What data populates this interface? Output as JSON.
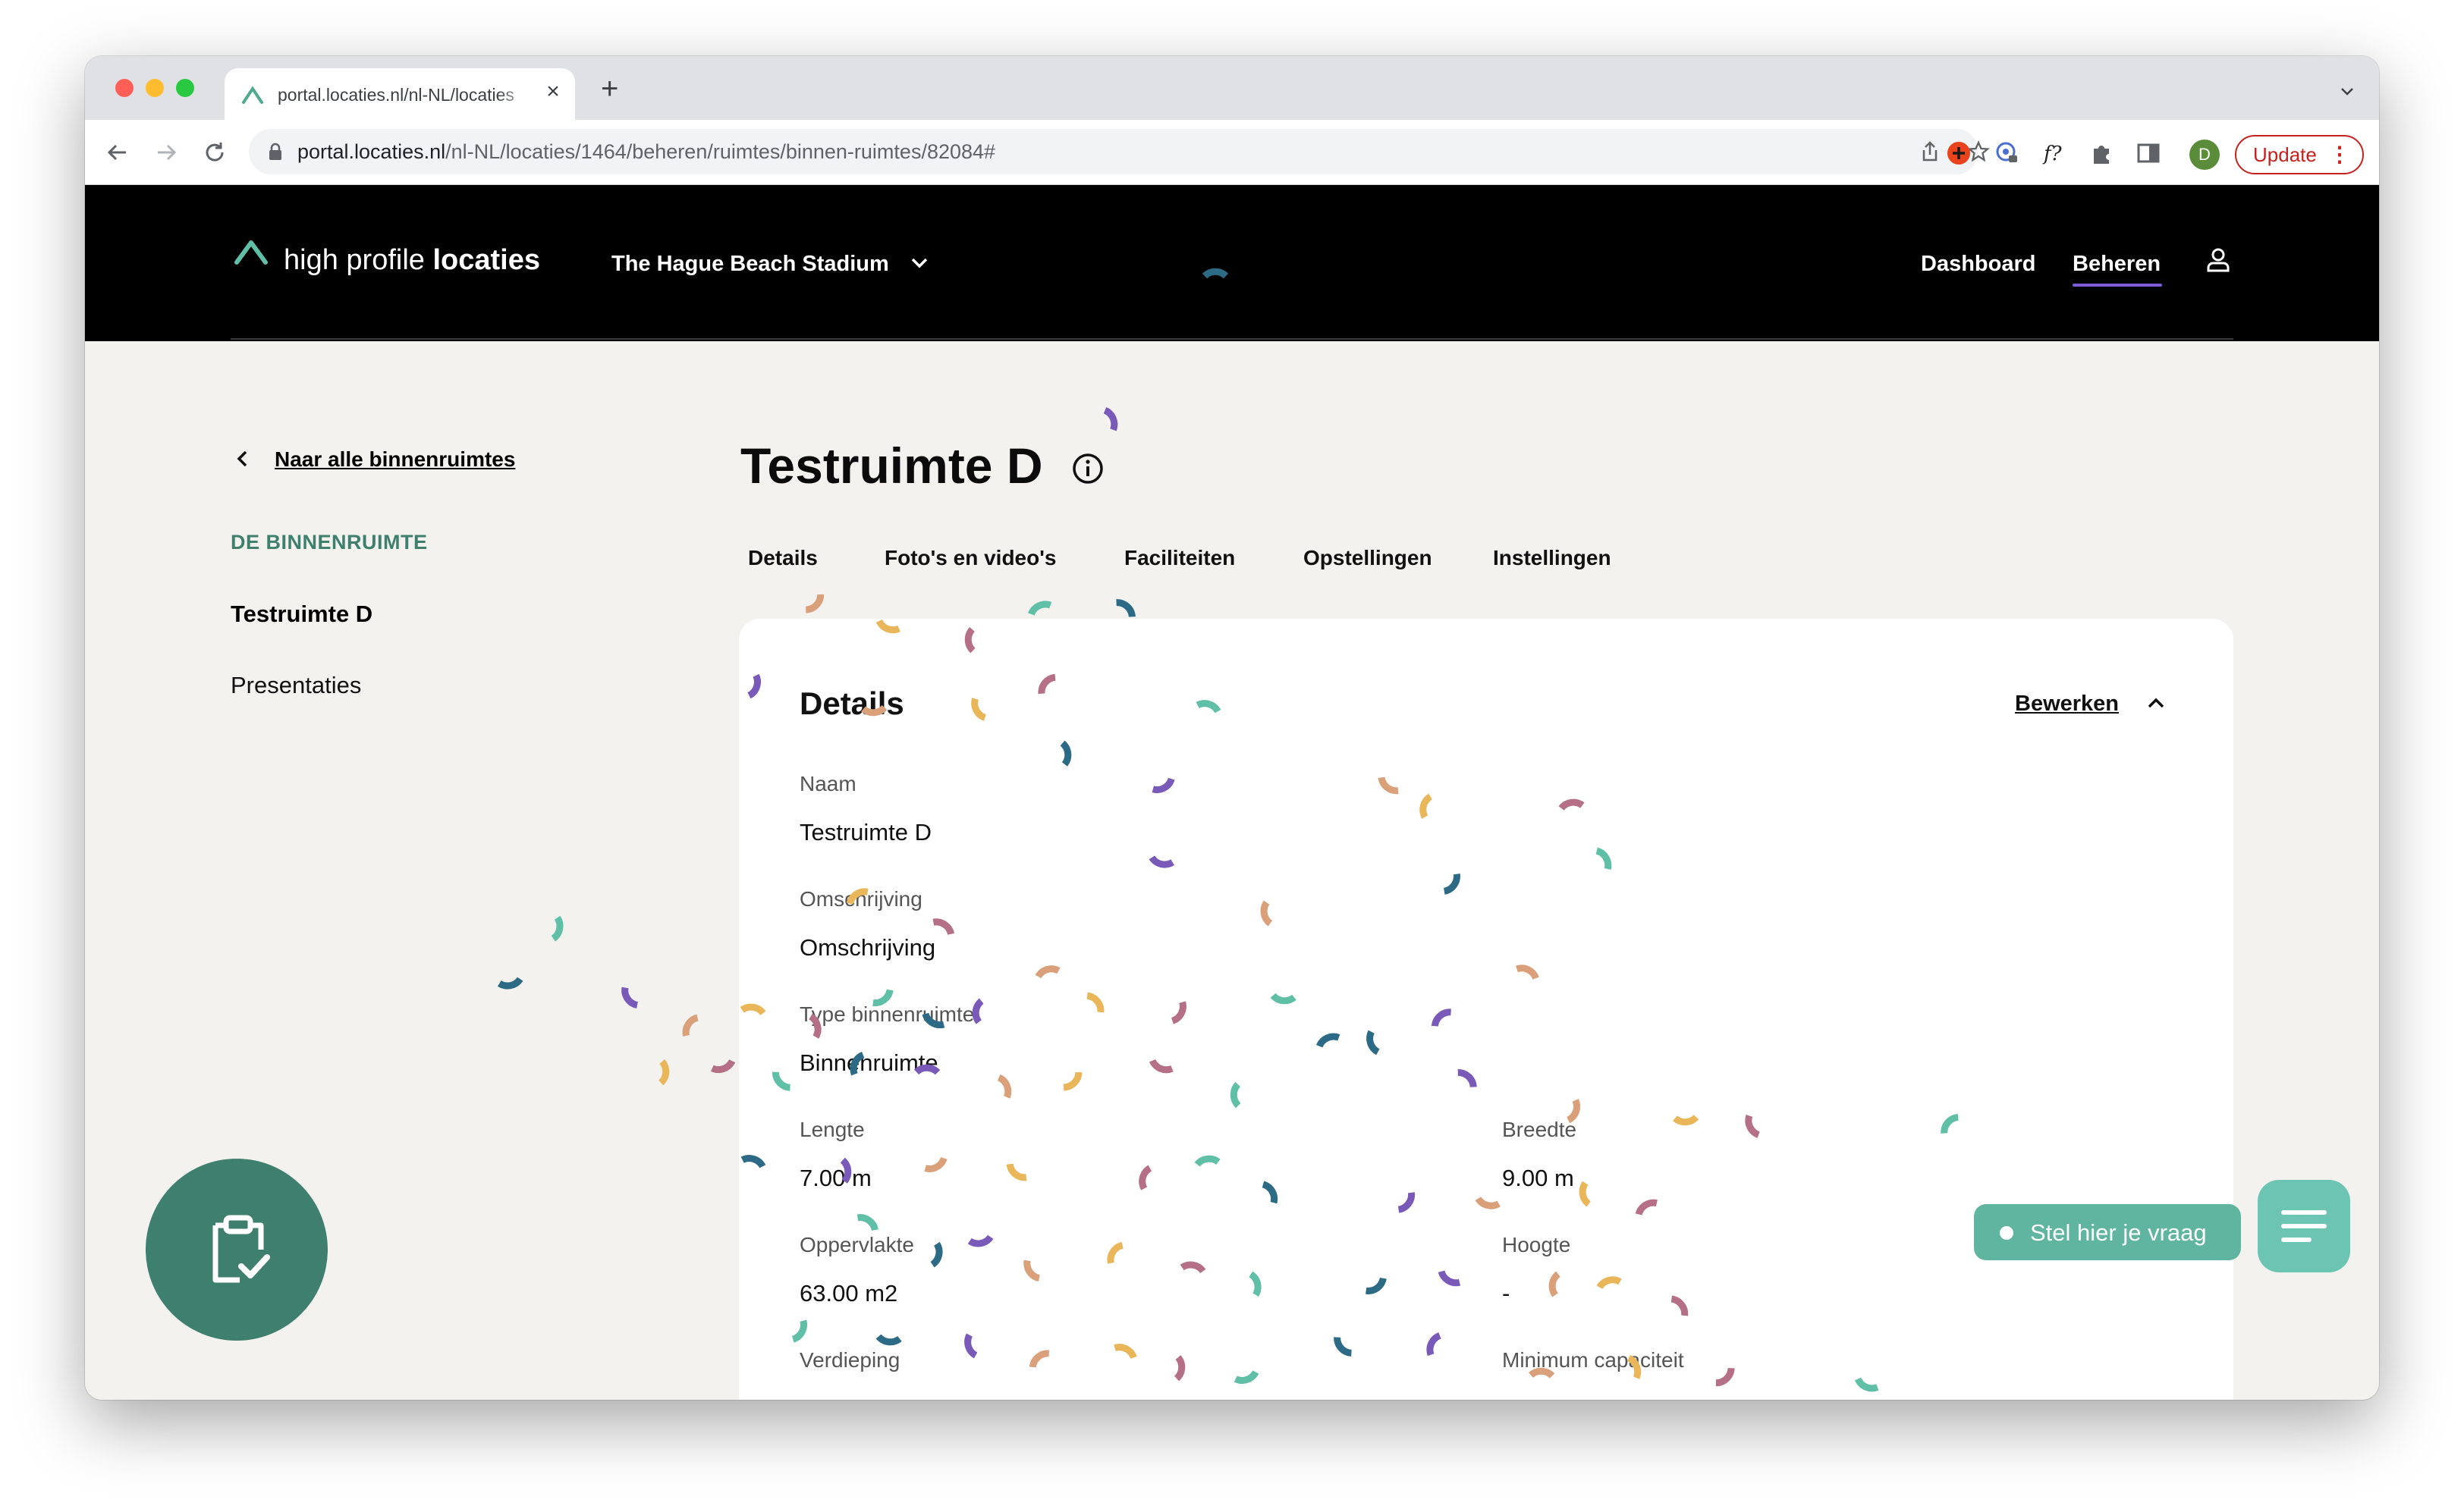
{
  "browser": {
    "tab_title": "portal.locaties.nl/nl-NL/locaties",
    "url_host": "portal.locaties.nl",
    "url_path": "/nl-NL/locaties/1464/beheren/ruimtes/binnen-ruimtes/82084#",
    "profile_initial": "D",
    "update_label": "Update"
  },
  "header": {
    "logo_light": "high profile ",
    "logo_bold": "locaties",
    "venue": "The Hague Beach Stadium",
    "nav": [
      "Dashboard",
      "Beheren"
    ]
  },
  "sidebar": {
    "back_label": "Naar alle binnenruimtes",
    "section_title": "DE BINNENRUIMTE",
    "items": [
      "Testruimte D",
      "Presentaties"
    ]
  },
  "main": {
    "title": "Testruimte D",
    "tabs": [
      "Details",
      "Foto's en video's",
      "Faciliteiten",
      "Opstellingen",
      "Instellingen"
    ],
    "card": {
      "title": "Details",
      "edit_label": "Bewerken",
      "fields": [
        {
          "label": "Naam",
          "value": "Testruimte D"
        },
        {
          "label": "Omschrijving",
          "value": "Omschrijving"
        },
        {
          "label": "Type binnenruimte",
          "value": "Binnenruimte"
        },
        {
          "label": "Lengte",
          "value": "7.00 m"
        },
        {
          "label": "Breedte",
          "value": "9.00 m"
        },
        {
          "label": "Oppervlakte",
          "value": "63.00 m2"
        },
        {
          "label": "Hoogte",
          "value": "-"
        },
        {
          "label": "Verdieping",
          "value": ""
        },
        {
          "label": "Minimum capaciteit",
          "value": ""
        }
      ]
    }
  },
  "widgets": {
    "ask_label": "Stel hier je vraag"
  },
  "colors": {
    "brand_green": "#3f7f6e",
    "chat_teal": "#5fb5a0",
    "nav_underline": "#7c5cd8",
    "confetti": [
      "#e9b65a",
      "#d9a07a",
      "#7a5ab8",
      "#2c6a85",
      "#5fbfa7",
      "#b56f86"
    ]
  },
  "icons": [
    "back-arrow-icon",
    "forward-arrow-icon",
    "reload-icon",
    "lock-icon",
    "share-icon",
    "bookmark-star-icon",
    "extensions-icon",
    "chevron-down-icon",
    "user-icon",
    "info-icon",
    "chevron-left-icon",
    "chevron-up-icon",
    "clipboard-check-icon",
    "menu-lines-icon"
  ]
}
